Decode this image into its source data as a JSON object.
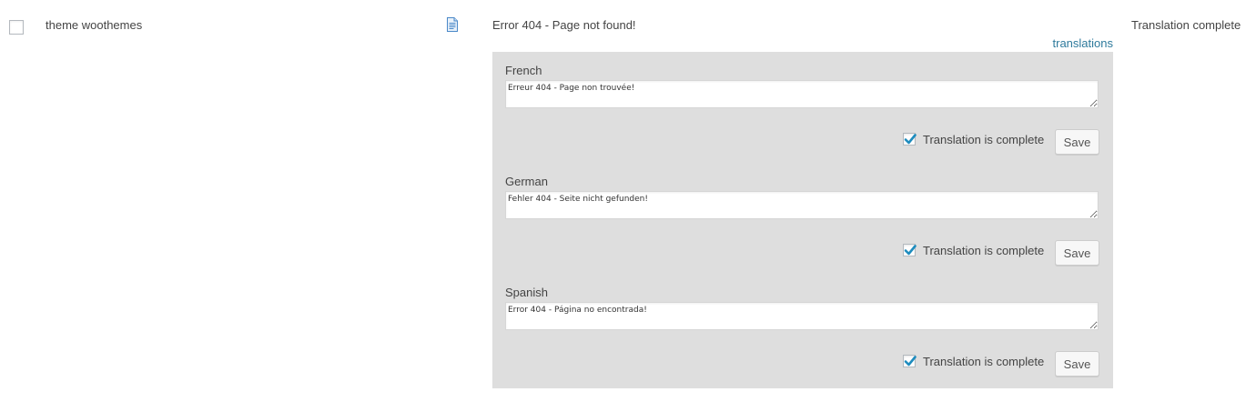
{
  "row": {
    "context": "theme woothemes",
    "original": "Error 404 - Page not found!",
    "translations_link": "translations",
    "status": "Translation complete",
    "icons": {
      "document": "document-icon",
      "checkmark": "checkmark-icon"
    },
    "colors": {
      "link": "#2e7a9c",
      "panel_bg": "#dedede",
      "check": "#1e8cbe"
    }
  },
  "translations": [
    {
      "language": "French",
      "text": "Erreur 404 - Page non trouvée!",
      "complete": true,
      "complete_label": "Translation is complete",
      "save_label": "Save"
    },
    {
      "language": "German",
      "text": "Fehler 404 - Seite nicht gefunden!",
      "complete": true,
      "complete_label": "Translation is complete",
      "save_label": "Save"
    },
    {
      "language": "Spanish",
      "text": "Error 404 - Página no encontrada!",
      "complete": true,
      "complete_label": "Translation is complete",
      "save_label": "Save"
    }
  ]
}
